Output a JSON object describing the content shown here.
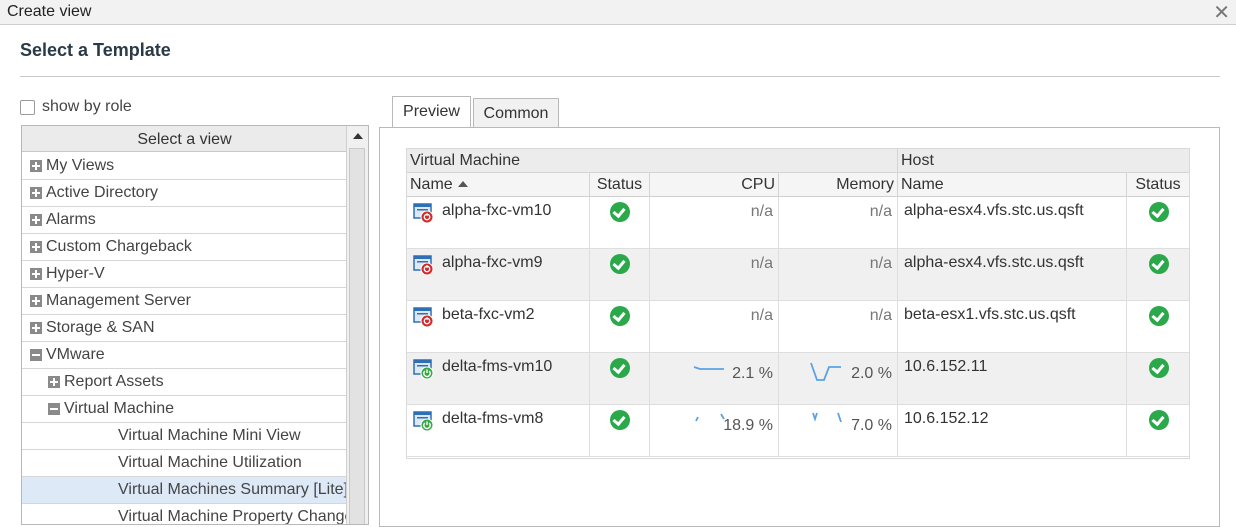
{
  "window": {
    "title": "Create view",
    "close_icon": "close-icon"
  },
  "heading": "Select a Template",
  "show_by_role": {
    "label": "show by role",
    "checked": false
  },
  "tree": {
    "header": "Select a view",
    "items": [
      {
        "label": "My Views",
        "expander": "plus"
      },
      {
        "label": "Active Directory",
        "expander": "plus"
      },
      {
        "label": "Alarms",
        "expander": "plus"
      },
      {
        "label": "Custom Chargeback",
        "expander": "plus"
      },
      {
        "label": "Hyper-V",
        "expander": "plus"
      },
      {
        "label": "Management Server",
        "expander": "plus"
      },
      {
        "label": "Storage & SAN",
        "expander": "plus"
      },
      {
        "label": "VMware",
        "expander": "minus"
      },
      {
        "label": "Report Assets",
        "expander": "plus"
      },
      {
        "label": "Virtual Machine",
        "expander": "minus"
      },
      {
        "label": "Virtual Machine Mini View",
        "expander": ""
      },
      {
        "label": "Virtual Machine Utilization",
        "expander": ""
      },
      {
        "label": "Virtual Machines Summary [Lite]",
        "expander": "",
        "selected": true
      },
      {
        "label": "Virtual Machine Property Change",
        "expander": ""
      }
    ]
  },
  "tabs": [
    {
      "label": "Preview",
      "active": true
    },
    {
      "label": "Common",
      "active": false
    }
  ],
  "grid": {
    "groups": [
      "Virtual Machine",
      "Host"
    ],
    "columns": [
      "Name",
      "Status",
      "CPU",
      "Memory",
      "Name",
      "Status"
    ],
    "status_ok_color": "#2aa84a",
    "rows": [
      {
        "vm": "alpha-fxc-vm10",
        "vm_state": "stopped",
        "cpu": "n/a",
        "memory": "n/a",
        "host": "alpha-esx4.vfs.stc.us.qsft"
      },
      {
        "vm": "alpha-fxc-vm9",
        "vm_state": "stopped",
        "cpu": "n/a",
        "memory": "n/a",
        "host": "alpha-esx4.vfs.stc.us.qsft"
      },
      {
        "vm": "beta-fxc-vm2",
        "vm_state": "stopped",
        "cpu": "n/a",
        "memory": "n/a",
        "host": "beta-esx1.vfs.stc.us.qsft"
      },
      {
        "vm": "delta-fms-vm10",
        "vm_state": "running",
        "cpu": "2.1 %",
        "memory": "2.0 %",
        "host": "10.6.152.11"
      },
      {
        "vm": "delta-fms-vm8",
        "vm_state": "running",
        "cpu": "18.9 %",
        "memory": "7.0 %",
        "host": "10.6.152.12"
      }
    ]
  }
}
